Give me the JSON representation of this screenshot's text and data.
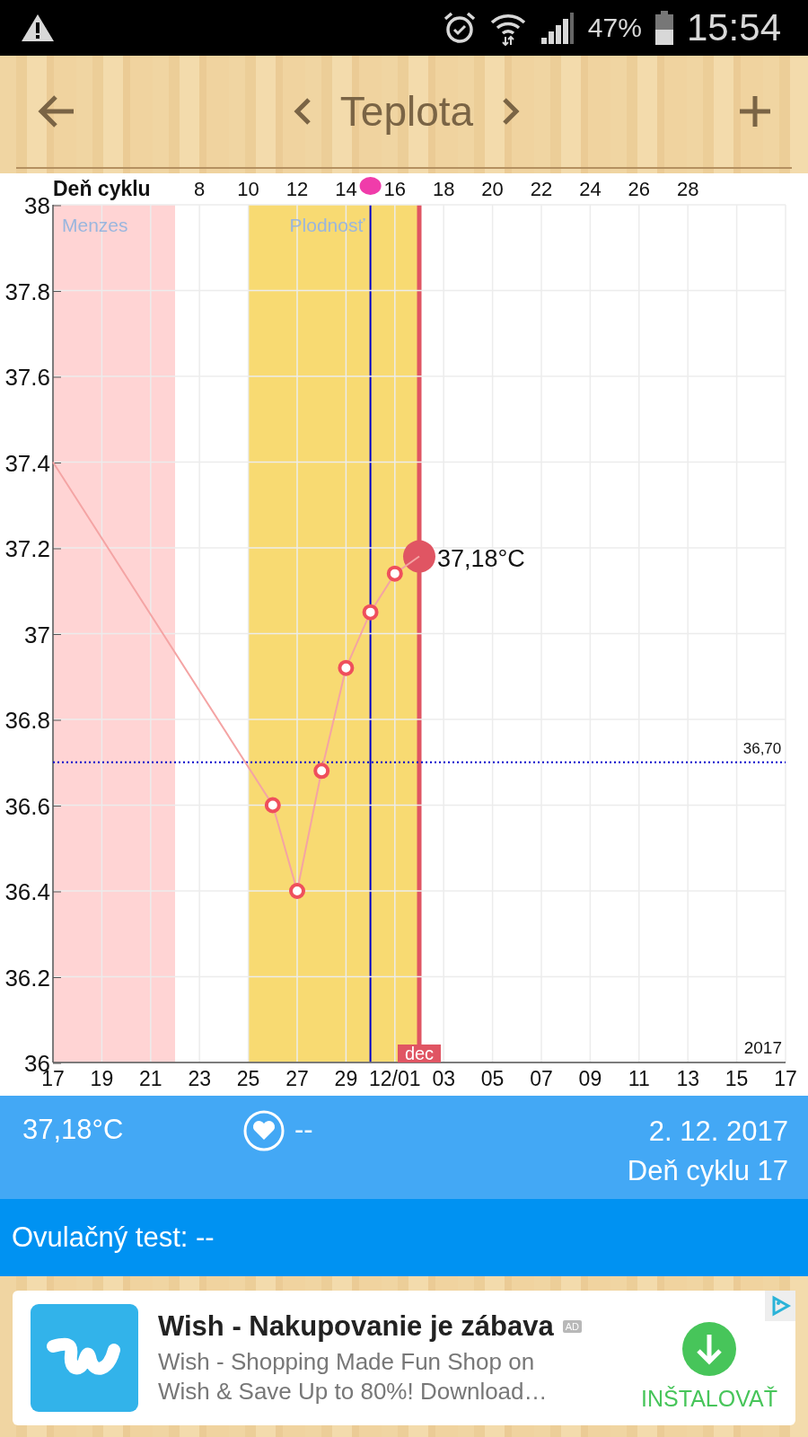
{
  "status_bar": {
    "battery": "47%",
    "time": "15:54"
  },
  "header": {
    "title": "Teplota"
  },
  "chart": {
    "chart_data": {
      "type": "line",
      "categories": [
        "17",
        null,
        "19",
        null,
        "21",
        null,
        "23",
        null,
        "25",
        null,
        "27",
        null,
        "29",
        null,
        "12/01",
        null,
        "03",
        null,
        "05",
        null,
        "07",
        null,
        "09",
        null,
        "11",
        null,
        "13",
        null,
        "15",
        null,
        "17"
      ],
      "series": [
        {
          "color": "#f4a4a4",
          "marker": "circle",
          "values": [
            37.4,
            null,
            null,
            null,
            null,
            null,
            null,
            null,
            null,
            36.6,
            36.4,
            36.68,
            36.92,
            37.05,
            37.14,
            37.18,
            null,
            null,
            null,
            null,
            null,
            null,
            null,
            null,
            null,
            null,
            null,
            null,
            null,
            null,
            null
          ]
        }
      ],
      "ylim": [
        36,
        38
      ],
      "grid": true,
      "yticks": [
        {
          "value": 36,
          "label": "36"
        },
        {
          "value": 36.2,
          "label": "36.2"
        },
        {
          "value": 36.4,
          "label": "36.4"
        },
        {
          "value": 36.6,
          "label": "36.6"
        },
        {
          "value": 36.8,
          "label": "36.8"
        },
        {
          "value": 37,
          "label": "37"
        },
        {
          "value": 37.2,
          "label": "37.2"
        },
        {
          "value": 37.4,
          "label": "37.4"
        },
        {
          "value": 37.6,
          "label": "37.6"
        },
        {
          "value": 37.8,
          "label": "37.8"
        },
        {
          "value": 38,
          "label": "38"
        }
      ],
      "ref_lines": [
        {
          "axis": "y",
          "value": 36.7,
          "label": "36,70",
          "color": "#0000cc"
        }
      ],
      "annotations": [
        "37,18°C",
        "2017"
      ]
    },
    "phases": [
      {
        "label": "Menzes"
      },
      {
        "label": "Plodnosť"
      }
    ],
    "month_tag": "dec",
    "cycle_axis": {
      "title": "Deň cyklu",
      "ticks": [
        "8",
        "10",
        "12",
        "14",
        "16",
        "18",
        "20",
        "22",
        "24",
        "26",
        "28"
      ]
    }
  },
  "summary": {
    "temperature": "37,18°C",
    "heart_value": "--",
    "date": "2. 12. 2017",
    "cycle_day": "Deň cyklu 17"
  },
  "ovulation": {
    "text": "Ovulačný test: --"
  },
  "ad": {
    "title": "Wish - Nakupovanie je zábava",
    "badge": "AD",
    "description": "Wish - Shopping Made Fun Shop on Wish & Save Up to 80%! Download…",
    "install": "INŠTALOVAŤ"
  }
}
